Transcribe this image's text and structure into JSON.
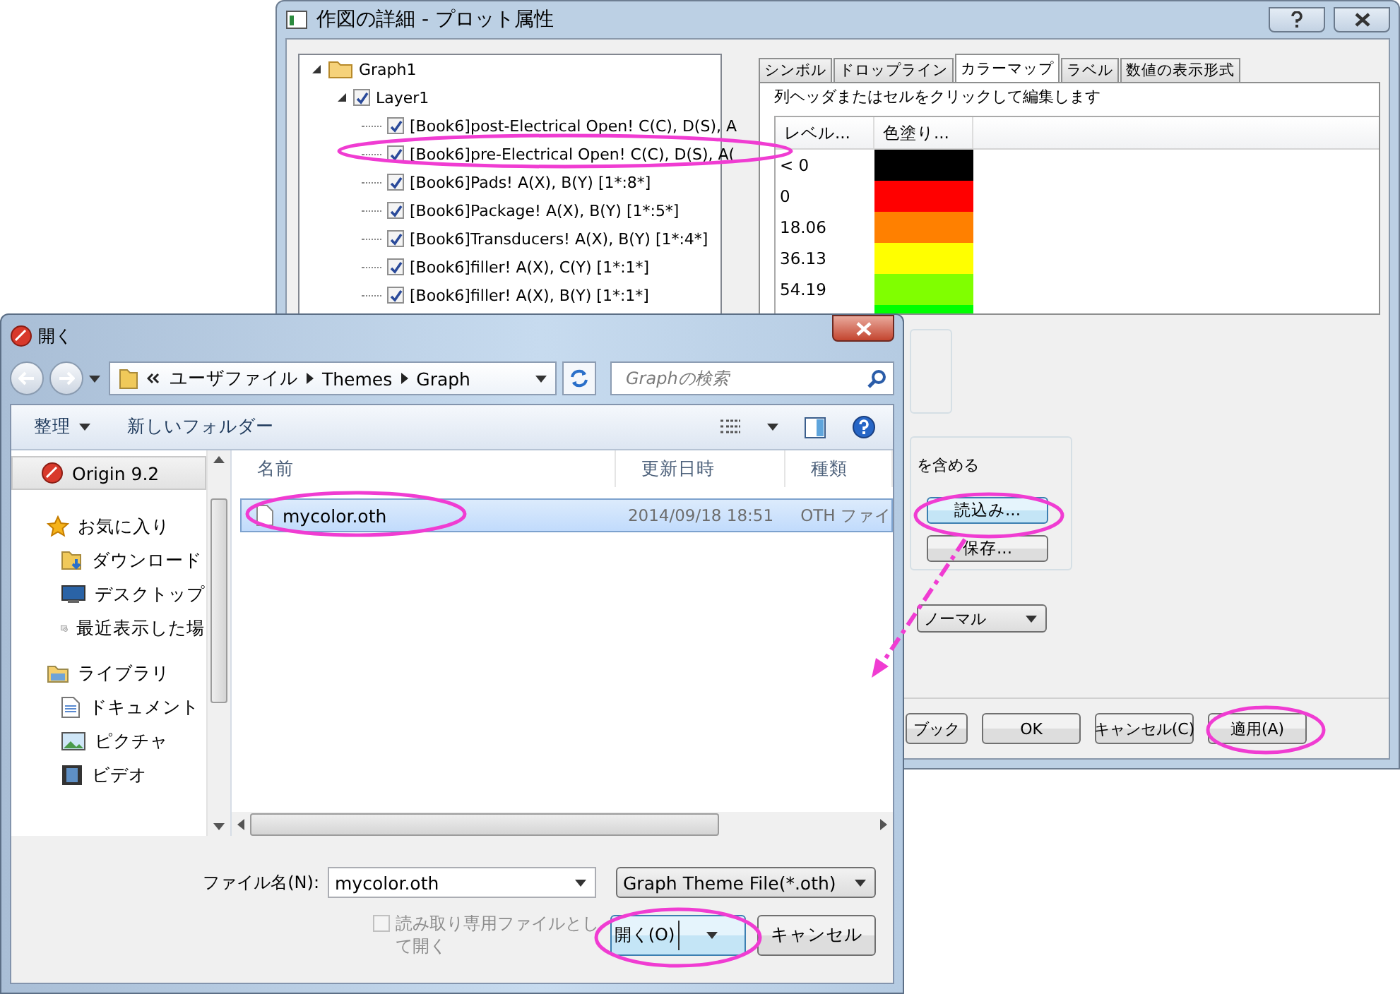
{
  "plot_dialog": {
    "title": "作図の詳細 - プロット属性",
    "tree": {
      "label": "Graph1",
      "expanded": true,
      "children": [
        {
          "label": "Layer1",
          "checked": true,
          "expanded": true,
          "children": [
            {
              "label": "[Book6]post-Electrical Open! C(C), D(S), A",
              "checked": true
            },
            {
              "label": "[Book6]pre-Electrical Open! C(C), D(S), A(",
              "checked": true
            },
            {
              "label": "[Book6]Pads! A(X), B(Y) [1*:8*]",
              "checked": true
            },
            {
              "label": "[Book6]Package! A(X), B(Y) [1*:5*]",
              "checked": true
            },
            {
              "label": "[Book6]Transducers! A(X), B(Y) [1*:4*]",
              "checked": true
            },
            {
              "label": "[Book6]filler! A(X), C(Y) [1*:1*]",
              "checked": true
            },
            {
              "label": "[Book6]filler! A(X), B(Y) [1*:1*]",
              "checked": true
            }
          ]
        }
      ]
    },
    "tabs": [
      {
        "label": "シンボル",
        "selected": false
      },
      {
        "label": "ドロップライン",
        "selected": false
      },
      {
        "label": "カラーマップ",
        "selected": true
      },
      {
        "label": "ラベル",
        "selected": false
      },
      {
        "label": "数値の表示形式",
        "selected": false
      }
    ],
    "hint": "列ヘッダまたはセルをクリックして編集します",
    "colormap": {
      "columns": [
        "レベル...",
        "色塗り..."
      ],
      "rows": [
        {
          "level": "< 0",
          "color": "#000000"
        },
        {
          "level": "0",
          "color": "#ff0000"
        },
        {
          "level": "18.06",
          "color": "#ff8000"
        },
        {
          "level": "36.13",
          "color": "#ffff00"
        },
        {
          "level": "54.19",
          "color": "#80ff00"
        },
        {
          "color": "#00ff00"
        }
      ]
    },
    "include_label": "を含める",
    "load_button": "読込み...",
    "save_button": "保存...",
    "blend_select": "ノーマル",
    "buttons": [
      "ブック",
      "OK",
      "キャンセル(C)",
      "適用(A)"
    ]
  },
  "open_dialog": {
    "title": "開く",
    "breadcrumb": [
      "ユーザファイル",
      "Themes",
      "Graph"
    ],
    "search": {
      "placeholder": "Graphの検索"
    },
    "toolbar": {
      "organize": "整理",
      "new_folder": "新しいフォルダー"
    },
    "sidebar": [
      {
        "kind": "pinned",
        "label": "Origin 9.2",
        "selected": true
      },
      {
        "kind": "group",
        "label": "お気に入り",
        "selected": false
      },
      {
        "kind": "item",
        "label": "ダウンロード",
        "selected": false
      },
      {
        "kind": "item",
        "label": "デスクトップ",
        "selected": false
      },
      {
        "kind": "item",
        "label": "最近表示した場",
        "selected": false
      },
      {
        "kind": "group",
        "label": "ライブラリ",
        "selected": false
      },
      {
        "kind": "item",
        "label": "ドキュメント",
        "selected": false
      },
      {
        "kind": "item",
        "label": "ピクチャ",
        "selected": false
      },
      {
        "kind": "item",
        "label": "ビデオ",
        "selected": false
      }
    ],
    "columns": [
      "名前",
      "更新日時",
      "種類"
    ],
    "files": [
      {
        "name": "mycolor.oth",
        "modified": "2014/09/18 18:51",
        "type": "OTH ファイ",
        "selected": true
      }
    ],
    "filename_label": "ファイル名(N):",
    "filename": "mycolor.oth",
    "filter": "Graph Theme File(*.oth)",
    "readonly": {
      "label": "読み取り専用ファイルとして開く",
      "checked": false,
      "disabled": true
    },
    "open_button": "開く(O)",
    "cancel_button": "キャンセル"
  }
}
